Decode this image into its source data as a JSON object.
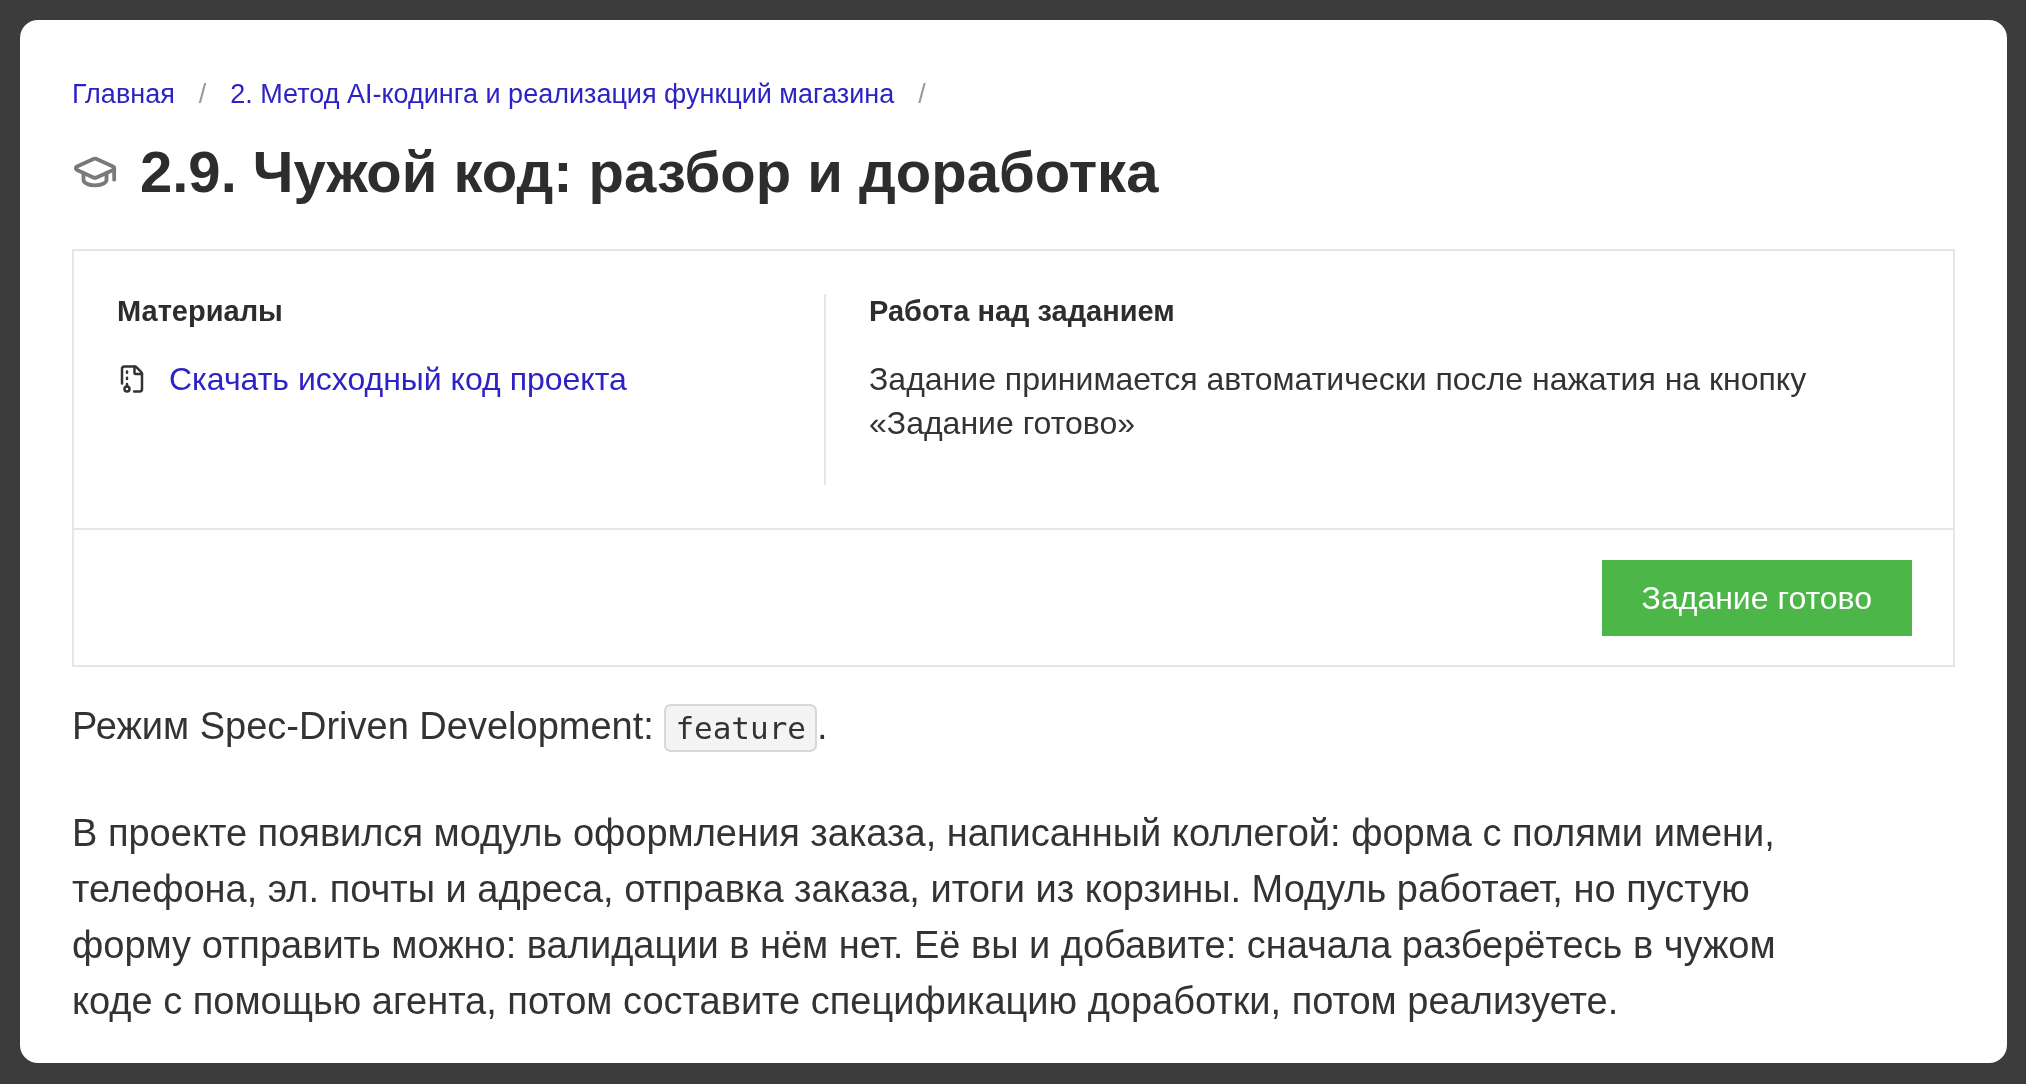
{
  "breadcrumb": [
    {
      "label": "Главная",
      "separator": "/"
    },
    {
      "label": "2. Метод AI-кодинга и реализация функций магазина",
      "separator": "/"
    }
  ],
  "title": "2.9. Чужой код: разбор и доработка",
  "task_card": {
    "materials": {
      "heading": "Материалы",
      "links": [
        {
          "label": "Скачать исходный код проекта"
        }
      ]
    },
    "work": {
      "heading": "Работа над заданием",
      "text": "Задание принимается автоматически после нажатия на кнопку «Задание готово»"
    },
    "button": "Задание готово"
  },
  "mode": {
    "text": "Режим Spec-Driven Development:",
    "code": "feature",
    "after": "."
  },
  "paragraphs": [
    "В проекте появился модуль оформления заказа, написанный коллегой: форма с полями имени, телефона, эл. почты и адреса, отправка заказа, итоги из корзины. Модуль работает, но пустую форму отправить можно: валидации в нём нет. Её вы и добавите: сначала разберётесь в чужом коде с помощью агента, потом составите спецификацию доработки, потом реализуете."
  ]
}
